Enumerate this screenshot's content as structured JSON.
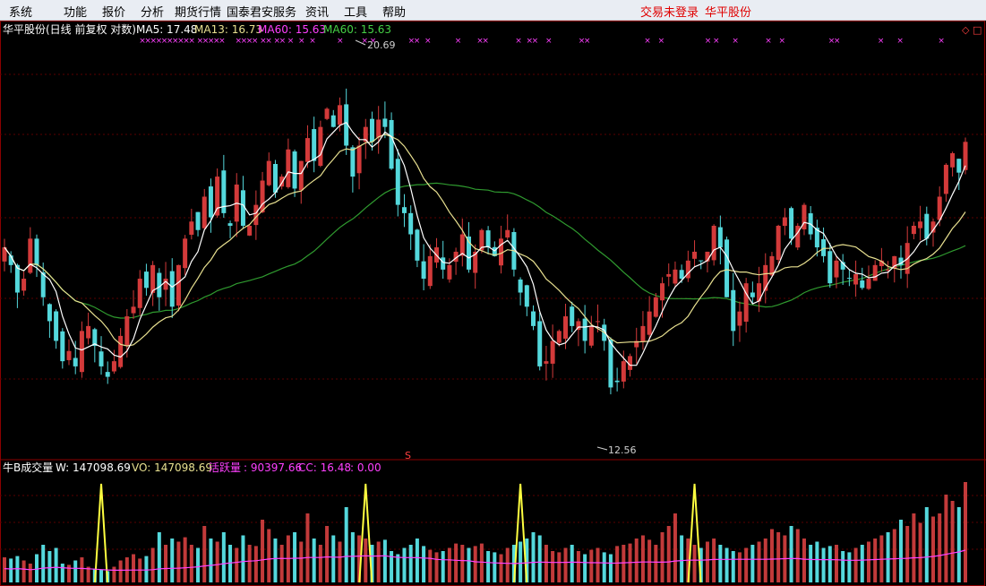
{
  "menu": {
    "items": [
      "系统",
      "功能",
      "报价",
      "分析",
      "期货行情",
      "国泰君安服务",
      "资讯",
      "工具",
      "帮助"
    ],
    "login_status": "交易未登录",
    "stock_name": "华平股份"
  },
  "colors": {
    "up": "#d33a3a",
    "down": "#54d8dc",
    "ma5": "#ffffff",
    "ma13": "#e8e090",
    "ma60": "#2f9a2f",
    "marker": "#ff40ff",
    "volume_up": "#c23a3a",
    "volume_down": "#54d8dc",
    "spike": "#ffff40",
    "active_line": "#ff40ff"
  },
  "price_panel": {
    "title": "华平股份(日线 前复权 对数)",
    "ma5_label": "MA5: 17.48",
    "ma13_label": "MA13: 16.73",
    "ma60_label_a": "MA60: 15.63",
    "ma60_label_b": "MA60: 15.63",
    "high_label": "20.69",
    "low_label": "12.56",
    "corner_icon": "diamond-icon",
    "mid_marker": "S"
  },
  "volume_panel": {
    "title": "牛B成交量",
    "w_label": "W: 147098.69",
    "vo_label": "VO: 147098.69",
    "active_name": "活跃量",
    "active_value": ": 90397.66",
    "cc_label": "CC: 16.48",
    "tail_label": ": 0.00"
  },
  "chart_data": {
    "type": "candlestick",
    "title": "华平股份(日线 前复权 对数)",
    "scale": "log",
    "price_range": [
      12.0,
      21.5
    ],
    "price_high": 20.69,
    "price_low": 12.56,
    "ma_legend": {
      "MA5": 17.48,
      "MA13": 16.73,
      "MA60": 15.63
    },
    "close": [
      16.0,
      15.6,
      15.0,
      15.3,
      16.2,
      15.6,
      14.9,
      14.4,
      14.0,
      13.6,
      13.8,
      13.5,
      14.2,
      14.3,
      13.9,
      13.5,
      13.3,
      13.6,
      14.1,
      14.5,
      14.7,
      15.3,
      15.1,
      15.6,
      14.9,
      15.3,
      14.7,
      15.6,
      16.2,
      16.6,
      16.4,
      17.2,
      16.7,
      17.7,
      16.8,
      16.5,
      17.5,
      16.5,
      16.5,
      17.0,
      17.6,
      18.1,
      17.3,
      17.7,
      18.4,
      17.4,
      18.1,
      18.7,
      18.1,
      19.0,
      19.5,
      19.0,
      19.6,
      18.5,
      17.7,
      18.5,
      19.0,
      18.6,
      19.2,
      19.0,
      17.9,
      17.0,
      16.8,
      16.3,
      15.7,
      15.3,
      15.8,
      16.0,
      15.5,
      15.6,
      15.9,
      16.3,
      15.5,
      15.9,
      16.4,
      16.0,
      15.8,
      16.2,
      16.4,
      15.5,
      15.0,
      14.7,
      14.3,
      13.5,
      13.6,
      14.0,
      14.2,
      14.5,
      14.3,
      14.4,
      14.0,
      14.3,
      14.4,
      14.0,
      13.1,
      13.2,
      13.6,
      13.7,
      14.0,
      14.3,
      14.6,
      14.9,
      15.2,
      15.4,
      15.5,
      15.3,
      15.7,
      15.9,
      15.7,
      15.9,
      16.5,
      16.0,
      14.9,
      14.2,
      14.6,
      15.2,
      14.9,
      15.2,
      15.6,
      15.8,
      16.5,
      16.7,
      16.2,
      16.5,
      17.0,
      16.3,
      16.0,
      15.8,
      15.2,
      15.7,
      15.5,
      15.3,
      15.4,
      15.1,
      15.3,
      15.6,
      15.7,
      15.5,
      15.8,
      15.6,
      16.1,
      16.5,
      16.6,
      16.2,
      16.6,
      17.2,
      18.0,
      18.3,
      17.8,
      18.6
    ],
    "volume": [
      40,
      38,
      42,
      35,
      30,
      45,
      60,
      50,
      55,
      30,
      28,
      35,
      40,
      25,
      22,
      20,
      18,
      25,
      35,
      40,
      45,
      38,
      42,
      55,
      80,
      60,
      70,
      65,
      72,
      60,
      55,
      90,
      70,
      65,
      80,
      60,
      55,
      75,
      60,
      58,
      100,
      85,
      70,
      60,
      75,
      80,
      65,
      110,
      70,
      60,
      90,
      75,
      65,
      120,
      80,
      75,
      70,
      60,
      65,
      68,
      50,
      45,
      55,
      60,
      70,
      58,
      52,
      48,
      50,
      55,
      62,
      60,
      55,
      58,
      62,
      50,
      48,
      45,
      55,
      60,
      65,
      70,
      80,
      75,
      60,
      50,
      48,
      55,
      60,
      50,
      45,
      52,
      55,
      48,
      45,
      58,
      60,
      62,
      70,
      75,
      68,
      60,
      80,
      90,
      110,
      75,
      70,
      60,
      55,
      65,
      70,
      60,
      55,
      50,
      48,
      55,
      60,
      65,
      70,
      85,
      80,
      75,
      90,
      85,
      70,
      60,
      65,
      55,
      58,
      60,
      50,
      48,
      55,
      60,
      65,
      70,
      75,
      80,
      85,
      100,
      90,
      110,
      95,
      120,
      105,
      110,
      140,
      130,
      120,
      160
    ],
    "spike_x_index": [
      15,
      56,
      80,
      107
    ]
  }
}
